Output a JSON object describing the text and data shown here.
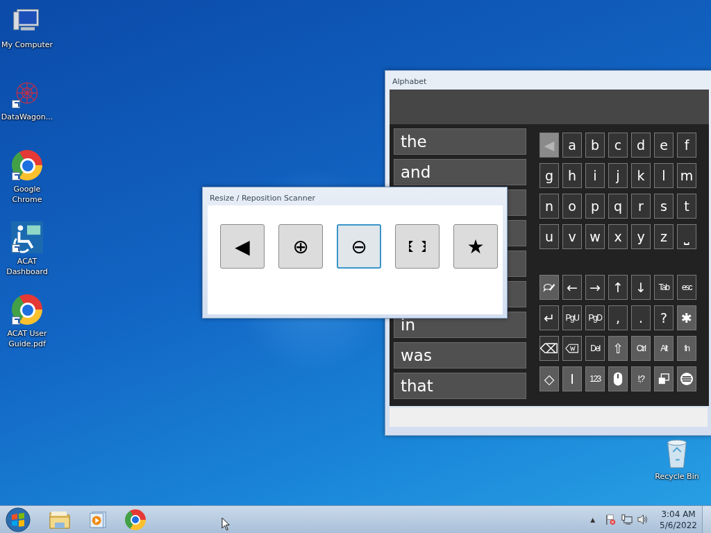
{
  "desktop": {
    "icons": [
      {
        "label": "My Computer",
        "shortcut": false
      },
      {
        "label": "DataWagon...",
        "shortcut": true
      },
      {
        "label": "Google Chrome",
        "shortcut": true
      },
      {
        "label": "ACAT Dashboard",
        "shortcut": true
      },
      {
        "label": "ACAT User Guide.pdf",
        "shortcut": true
      }
    ],
    "recycle_bin": {
      "label": "Recycle Bin"
    }
  },
  "alphabet_window": {
    "title": "Alphabet",
    "word_rows": [
      {
        "word": "the"
      },
      {
        "word": "and"
      },
      {},
      {},
      {},
      {},
      {
        "word": "in"
      },
      {
        "word": "was"
      },
      {
        "word": "that"
      }
    ],
    "key_blocks": [
      [
        [
          {
            "kind": "text",
            "label": "◀",
            "highlighted": false,
            "disabled": true
          },
          {
            "kind": "text",
            "label": "a",
            "highlighted": false,
            "disabled": false
          },
          {
            "kind": "text",
            "label": "b",
            "highlighted": false,
            "disabled": false
          },
          {
            "kind": "text",
            "label": "c",
            "highlighted": false,
            "disabled": false
          },
          {
            "kind": "text",
            "label": "d",
            "highlighted": false,
            "disabled": false
          },
          {
            "kind": "text",
            "label": "e",
            "highlighted": false,
            "disabled": false
          },
          {
            "kind": "text",
            "label": "f",
            "highlighted": false,
            "disabled": false
          }
        ],
        [
          {
            "kind": "text",
            "label": "g",
            "highlighted": false,
            "disabled": false
          },
          {
            "kind": "text",
            "label": "h",
            "highlighted": false,
            "disabled": false
          },
          {
            "kind": "text",
            "label": "i",
            "highlighted": false,
            "disabled": false
          },
          {
            "kind": "text",
            "label": "j",
            "highlighted": false,
            "disabled": false
          },
          {
            "kind": "text",
            "label": "k",
            "highlighted": false,
            "disabled": false
          },
          {
            "kind": "text",
            "label": "l",
            "highlighted": false,
            "disabled": false
          },
          {
            "kind": "text",
            "label": "m",
            "highlighted": false,
            "disabled": false
          }
        ],
        [
          {
            "kind": "text",
            "label": "n",
            "highlighted": false,
            "disabled": false
          },
          {
            "kind": "text",
            "label": "o",
            "highlighted": false,
            "disabled": false
          },
          {
            "kind": "text",
            "label": "p",
            "highlighted": false,
            "disabled": false
          },
          {
            "kind": "text",
            "label": "q",
            "highlighted": false,
            "disabled": false
          },
          {
            "kind": "text",
            "label": "r",
            "highlighted": false,
            "disabled": false
          },
          {
            "kind": "text",
            "label": "s",
            "highlighted": false,
            "disabled": false
          },
          {
            "kind": "text",
            "label": "t",
            "highlighted": false,
            "disabled": false
          }
        ],
        [
          {
            "kind": "text",
            "label": "u",
            "highlighted": false,
            "disabled": false
          },
          {
            "kind": "text",
            "label": "v",
            "highlighted": false,
            "disabled": false
          },
          {
            "kind": "text",
            "label": "w",
            "highlighted": false,
            "disabled": false
          },
          {
            "kind": "text",
            "label": "x",
            "highlighted": false,
            "disabled": false
          },
          {
            "kind": "text",
            "label": "y",
            "highlighted": false,
            "disabled": false
          },
          {
            "kind": "text",
            "label": "z",
            "highlighted": false,
            "disabled": false
          },
          {
            "kind": "text",
            "label": "⎵",
            "highlighted": false,
            "disabled": false
          }
        ]
      ],
      [
        [
          {
            "kind": "icon",
            "highlighted": true,
            "disabled": false
          },
          {
            "kind": "text",
            "label": "←",
            "highlighted": false,
            "disabled": false
          },
          {
            "kind": "text",
            "label": "→",
            "highlighted": false,
            "disabled": false
          },
          {
            "kind": "text",
            "label": "↑",
            "highlighted": false,
            "disabled": false
          },
          {
            "kind": "text",
            "label": "↓",
            "highlighted": false,
            "disabled": false
          },
          {
            "kind": "text",
            "label": "Tab",
            "highlighted": false,
            "disabled": false
          },
          {
            "kind": "text",
            "label": "esc",
            "highlighted": false,
            "disabled": false
          }
        ],
        [
          {
            "kind": "text",
            "label": "↵",
            "highlighted": false,
            "disabled": false
          },
          {
            "kind": "text",
            "label": "PgU",
            "highlighted": false,
            "disabled": false
          },
          {
            "kind": "text",
            "label": "PgD",
            "highlighted": false,
            "disabled": false
          },
          {
            "kind": "text",
            "label": ",",
            "highlighted": false,
            "disabled": false
          },
          {
            "kind": "text",
            "label": ".",
            "highlighted": false,
            "disabled": false
          },
          {
            "kind": "text",
            "label": "?",
            "highlighted": false,
            "disabled": false
          },
          {
            "kind": "text",
            "label": "✱",
            "highlighted": true,
            "disabled": false
          }
        ],
        [
          {
            "kind": "text",
            "label": "⌫",
            "highlighted": false,
            "disabled": false
          },
          {
            "kind": "icon",
            "highlighted": false,
            "disabled": false
          },
          {
            "kind": "text",
            "label": "Del",
            "highlighted": false,
            "disabled": false
          },
          {
            "kind": "text",
            "label": "⇧",
            "highlighted": true,
            "disabled": false
          },
          {
            "kind": "text",
            "label": "Ctrl",
            "highlighted": true,
            "disabled": false
          },
          {
            "kind": "text",
            "label": "Alt",
            "highlighted": true,
            "disabled": false
          },
          {
            "kind": "text",
            "label": "fn",
            "highlighted": true,
            "disabled": false
          }
        ],
        [
          {
            "kind": "text",
            "label": "◇",
            "highlighted": true,
            "disabled": false
          },
          {
            "kind": "text",
            "label": "I",
            "highlighted": true,
            "disabled": false
          },
          {
            "kind": "text",
            "label": "123",
            "highlighted": true,
            "disabled": false
          },
          {
            "kind": "icon",
            "highlighted": true,
            "disabled": false
          },
          {
            "kind": "text",
            "label": "!;?",
            "highlighted": true,
            "disabled": false
          },
          {
            "kind": "icon",
            "highlighted": true,
            "disabled": false
          },
          {
            "kind": "icon",
            "highlighted": true,
            "disabled": false
          }
        ]
      ]
    ]
  },
  "scanner_window": {
    "title": "Resize / Reposition Scanner",
    "buttons": [
      {
        "kind": "text",
        "symbol": "◀",
        "selected": false
      },
      {
        "kind": "text",
        "symbol": "⊕",
        "selected": false
      },
      {
        "kind": "text",
        "symbol": "⊖",
        "selected": true
      },
      {
        "kind": "icon",
        "selected": false
      },
      {
        "kind": "text",
        "symbol": "★",
        "selected": false
      }
    ]
  },
  "taskbar": {
    "tray": {
      "overflow": "▲",
      "time": "3:04 AM",
      "date": "5/6/2022"
    }
  }
}
